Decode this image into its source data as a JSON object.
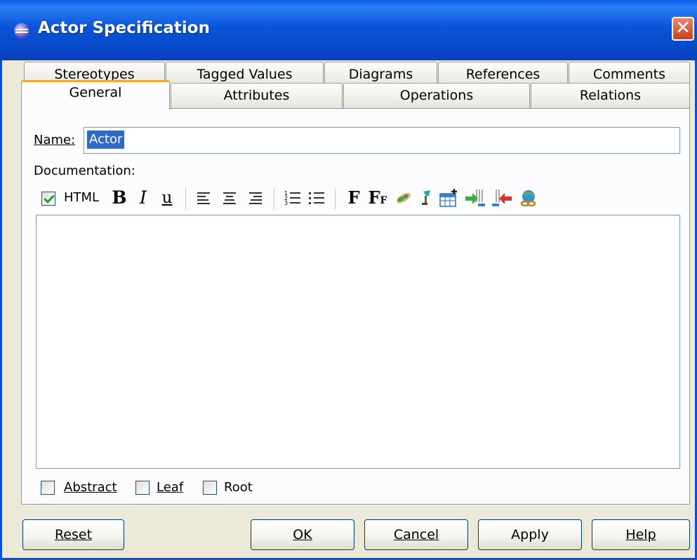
{
  "window": {
    "title": "Actor Specification"
  },
  "tabs": {
    "back_row": [
      {
        "label": "Stereotypes"
      },
      {
        "label": "Tagged Values"
      },
      {
        "label": "Diagrams"
      },
      {
        "label": "References"
      },
      {
        "label": "Comments"
      }
    ],
    "front_row": [
      {
        "label": "General",
        "active": true
      },
      {
        "label": "Attributes"
      },
      {
        "label": "Operations"
      },
      {
        "label": "Relations"
      }
    ]
  },
  "general": {
    "name_label": "Name:",
    "name_value": "Actor",
    "documentation_label": "Documentation:"
  },
  "toolbar": {
    "html_checked": true,
    "html_label": "HTML",
    "bold": "B",
    "italic": "I",
    "underline": "u",
    "font": "F",
    "font_size": "F",
    "font_size_small": "F",
    "icons": [
      "bold-icon",
      "italic-icon",
      "underline-icon",
      "align-left-icon",
      "align-center-icon",
      "align-right-icon",
      "numbered-list-icon",
      "bullet-list-icon",
      "font-icon",
      "font-size-icon",
      "color-brush-icon",
      "highlight-icon",
      "insert-table-icon",
      "insert-row-icon",
      "delete-row-icon",
      "link-icon"
    ]
  },
  "checkboxes": [
    {
      "label": "Abstract",
      "checked": false
    },
    {
      "label": "Leaf",
      "checked": false
    },
    {
      "label": "Root",
      "checked": false
    }
  ],
  "buttons": {
    "reset": "Reset",
    "ok": "OK",
    "cancel": "Cancel",
    "apply": "Apply",
    "help": "Help"
  },
  "colors": {
    "titlebar": "#0a54d9",
    "active_tab_accent": "#f4a832",
    "selection": "#316ac5",
    "check": "#21a121"
  }
}
